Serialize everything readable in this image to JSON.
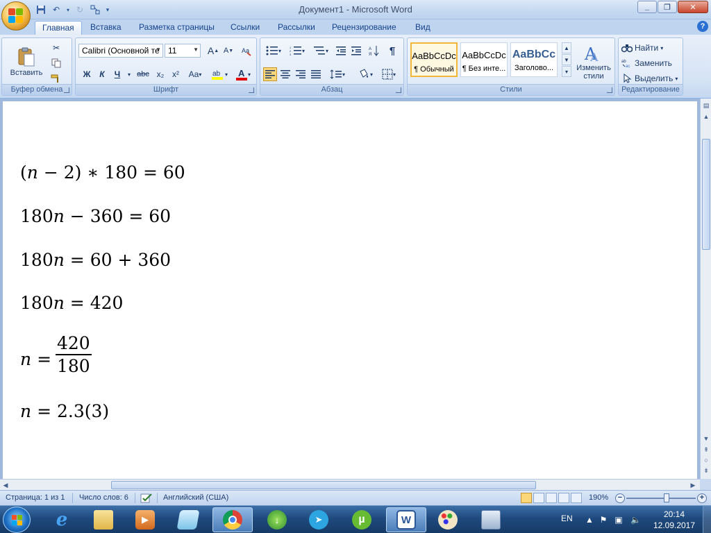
{
  "window": {
    "title": "Документ1 - Microsoft Word",
    "minimize": "_",
    "maximize": "❐",
    "close": "✕"
  },
  "tabs": [
    {
      "label": "Главная",
      "active": true
    },
    {
      "label": "Вставка"
    },
    {
      "label": "Разметка страницы"
    },
    {
      "label": "Ссылки"
    },
    {
      "label": "Рассылки"
    },
    {
      "label": "Рецензирование"
    },
    {
      "label": "Вид"
    }
  ],
  "ribbon": {
    "clipboard": {
      "label": "Буфер обмена",
      "paste": "Вставить"
    },
    "font": {
      "label": "Шрифт",
      "font_name": "Calibri (Основной те",
      "font_size": "11",
      "bold": "Ж",
      "italic": "К",
      "underline": "Ч",
      "strike": "abc",
      "subscript": "x₂",
      "superscript": "x²",
      "change_case": "Aa",
      "grow": "A",
      "shrink": "A"
    },
    "paragraph": {
      "label": "Абзац",
      "pilcrow": "¶"
    },
    "styles": {
      "label": "Стили",
      "items": [
        {
          "sample": "AaBbCcDc",
          "name": "¶ Обычный"
        },
        {
          "sample": "AaBbCcDc",
          "name": "¶ Без инте..."
        },
        {
          "sample": "AaBbCc",
          "name": "Заголово..."
        }
      ],
      "change_styles": "Изменить стили"
    },
    "editing": {
      "label": "Редактирование",
      "find": "Найти",
      "replace": "Заменить",
      "select": "Выделить"
    }
  },
  "document": {
    "equations": [
      "(n − 2) ∗ 180 = 60",
      "180n − 360 = 60",
      "180n = 60 + 360",
      "180n = 420"
    ],
    "fraction": {
      "lhs": "n =",
      "numerator": "420",
      "denominator": "180"
    },
    "result": "n = 2.3(3)"
  },
  "statusbar": {
    "page": "Страница: 1 из 1",
    "words": "Число слов: 6",
    "language": "Английский (США)",
    "zoom": "190%"
  },
  "taskbar": {
    "language": "EN",
    "time": "20:14",
    "date": "12.09.2017",
    "apps": [
      "internet-explorer",
      "file-explorer",
      "media-player",
      "notepad",
      "chrome",
      "download-manager",
      "telegram",
      "utorrent",
      "word",
      "paint",
      "calculator"
    ]
  }
}
